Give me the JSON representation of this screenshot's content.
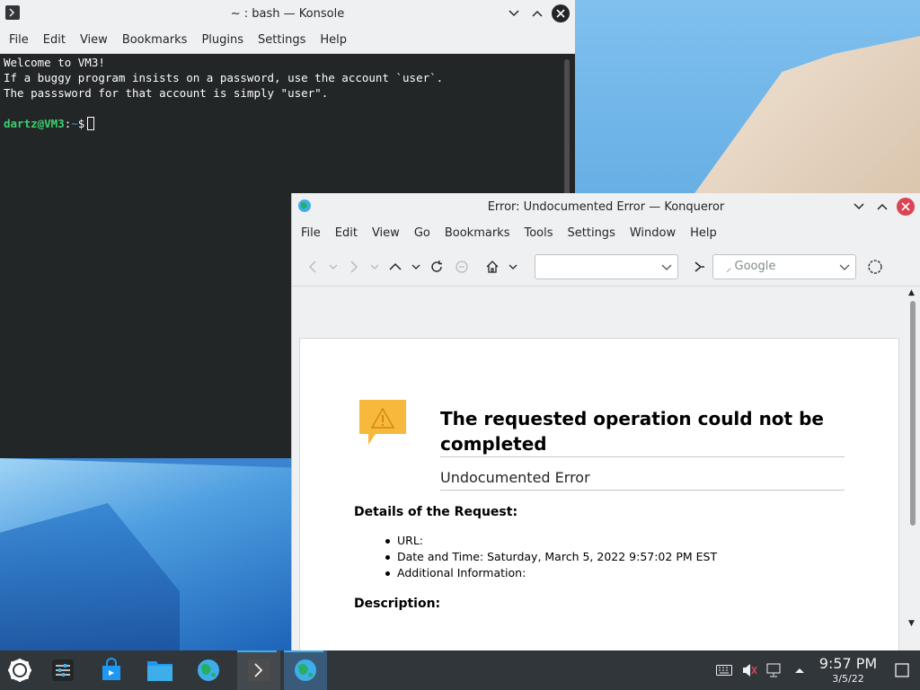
{
  "konsole": {
    "title": "~ : bash — Konsole",
    "menu": [
      "File",
      "Edit",
      "View",
      "Bookmarks",
      "Plugins",
      "Settings",
      "Help"
    ],
    "lines": [
      "Welcome to VM3!",
      "If a buggy program insists on a password, use the account `user`.",
      "The passsword for that account is simply \"user\"."
    ],
    "prompt_user": "dartz@VM3",
    "prompt_sep": ":",
    "prompt_path": "~",
    "prompt_symbol": "$"
  },
  "konqueror": {
    "title": "Error: Undocumented Error — Konqueror",
    "menu": [
      "File",
      "Edit",
      "View",
      "Go",
      "Bookmarks",
      "Tools",
      "Settings",
      "Window",
      "Help"
    ],
    "url_value": "",
    "search_placeholder": "Google",
    "error": {
      "heading": "The requested operation could not be completed",
      "subheading": "Undocumented Error",
      "details_heading": "Details of the Request:",
      "details": [
        "URL:",
        "Date and Time: Saturday, March 5, 2022 9:57:02 PM EST",
        "Additional Information:"
      ],
      "description_heading": "Description:"
    }
  },
  "taskbar": {
    "clock_time": "9:57 PM",
    "clock_date": "3/5/22"
  },
  "colors": {
    "accent": "#3daee9",
    "terminal_bg": "#232627",
    "prompt_user": "#3cd070",
    "warning": "#f6b93b",
    "close_button": "#da4453"
  }
}
